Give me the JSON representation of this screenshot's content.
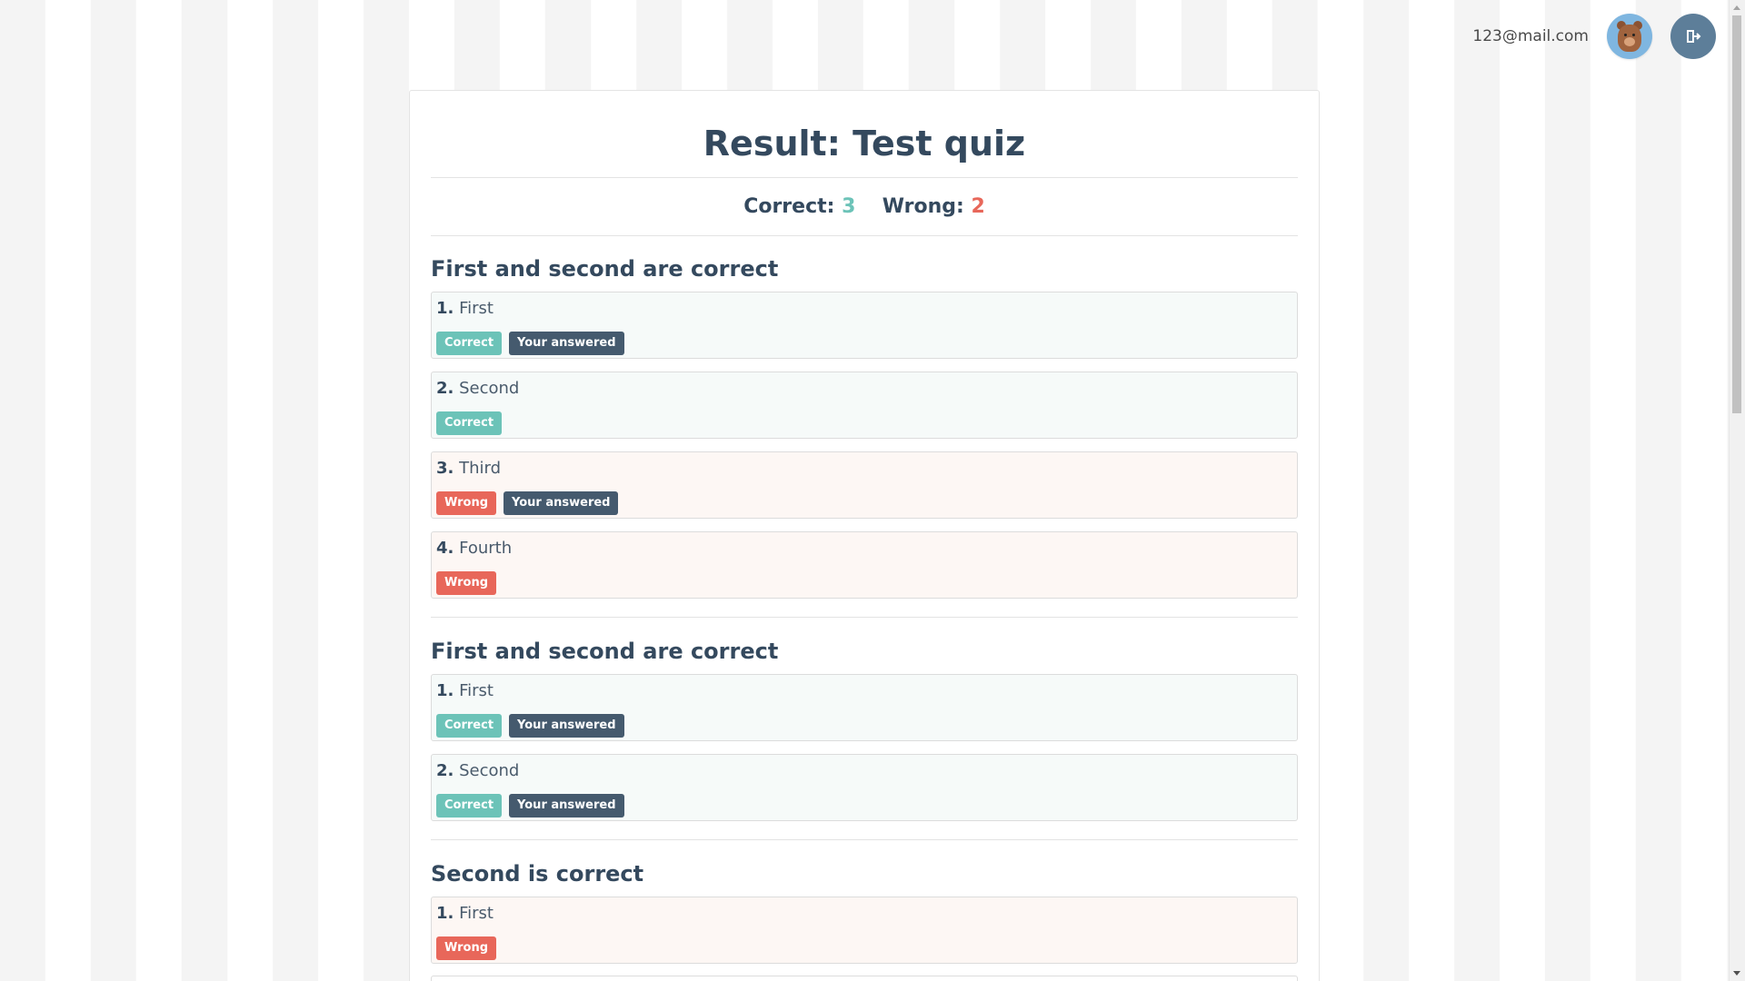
{
  "user": {
    "email": "123@mail.com"
  },
  "quiz": {
    "title": "Result: Test quiz",
    "correct_label": "Correct:",
    "correct_count": "3",
    "wrong_label": "Wrong:",
    "wrong_count": "2"
  },
  "tags": {
    "correct": "Correct",
    "wrong": "Wrong",
    "answered": "Your answered"
  },
  "questions": [
    {
      "title": "First and second are correct",
      "answers": [
        {
          "num": "1.",
          "text": "First"
        },
        {
          "num": "2.",
          "text": "Second"
        },
        {
          "num": "3.",
          "text": "Third"
        },
        {
          "num": "4.",
          "text": "Fourth"
        }
      ]
    },
    {
      "title": "First and second are correct",
      "answers": [
        {
          "num": "1.",
          "text": "First"
        },
        {
          "num": "2.",
          "text": "Second"
        }
      ]
    },
    {
      "title": "Second is correct",
      "answers": [
        {
          "num": "1.",
          "text": "First"
        }
      ]
    }
  ],
  "colors": {
    "correct": "#6cc3b8",
    "wrong": "#e8675a",
    "answered": "#455a6e",
    "text": "#34495e",
    "logout_button": "#5d7e99"
  },
  "icons": {
    "avatar": "bear-avatar",
    "logout": "logout-icon"
  }
}
